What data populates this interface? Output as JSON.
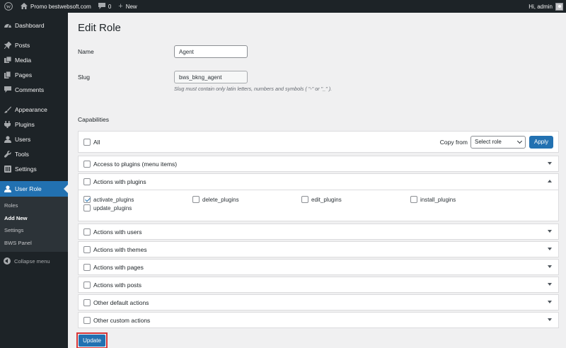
{
  "adminbar": {
    "site_name": "Promo bestwebsoft.com",
    "comments_count": "0",
    "new_label": "New",
    "greeting": "Hi, admin"
  },
  "menu": {
    "dashboard": "Dashboard",
    "posts": "Posts",
    "media": "Media",
    "pages": "Pages",
    "comments": "Comments",
    "appearance": "Appearance",
    "plugins": "Plugins",
    "users": "Users",
    "tools": "Tools",
    "settings": "Settings",
    "user_role": "User Role",
    "sub": [
      "Roles",
      "Add New",
      "Settings",
      "BWS Panel"
    ],
    "collapse": "Collapse menu"
  },
  "page": {
    "title": "Edit Role",
    "name_label": "Name",
    "name_value": "Agent",
    "slug_label": "Slug",
    "slug_value": "bws_bkng_agent",
    "slug_desc": "Slug must contain only latin letters, numbers and symbols ( \"-\" or \"_\" ).",
    "capabilities_label": "Capabilities",
    "all_label": "All",
    "copy_from_label": "Copy from",
    "select_placeholder": "Select role",
    "apply_label": "Apply",
    "groups": [
      "Access to plugins (menu items)",
      "Actions with plugins",
      "Actions with users",
      "Actions with themes",
      "Actions with pages",
      "Actions with posts",
      "Other default actions",
      "Other custom actions"
    ],
    "plugin_caps": [
      "activate_plugins",
      "delete_plugins",
      "edit_plugins",
      "install_plugins",
      "update_plugins"
    ],
    "update_label": "Update"
  }
}
